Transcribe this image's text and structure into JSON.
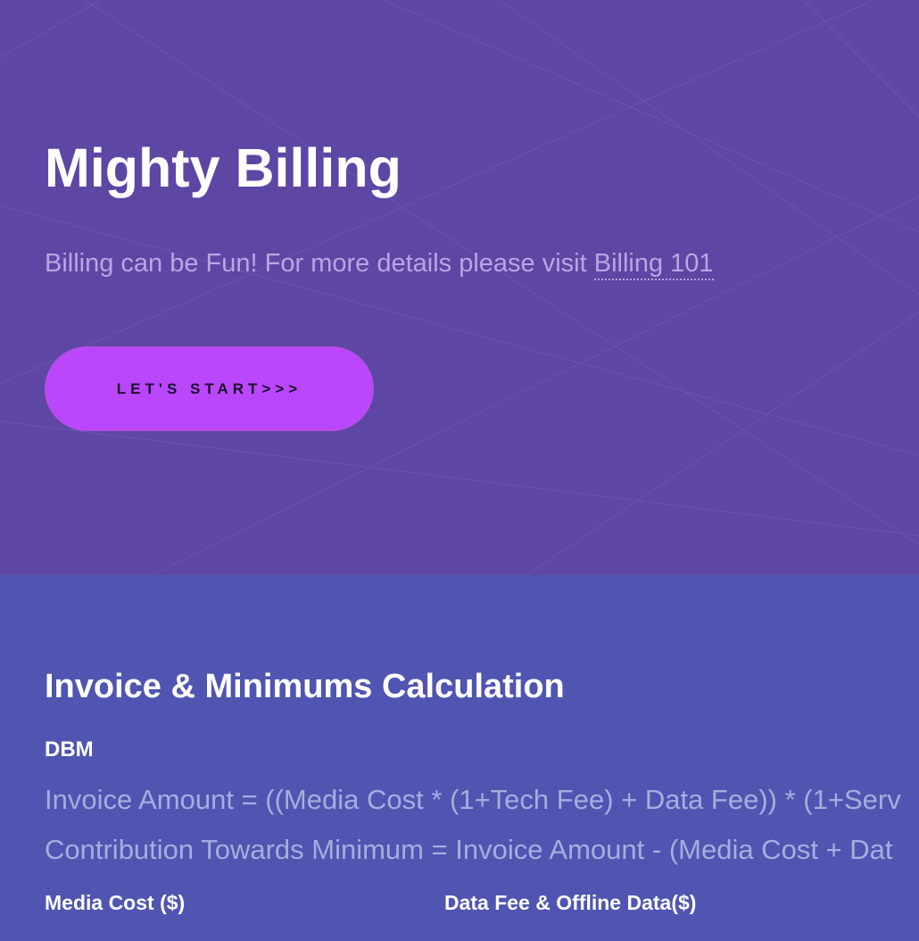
{
  "hero": {
    "title": "Mighty Billing",
    "subtitle_text": "Billing can be Fun! For more details please visit ",
    "subtitle_link": "Billing 101",
    "start_button": "LET'S START>>>"
  },
  "calculation": {
    "heading": "Invoice & Minimums Calculation",
    "subheading": "DBM",
    "formulas": [
      "Invoice Amount = ((Media Cost * (1+Tech Fee) + Data Fee)) * (1+Serv",
      "Contribution Towards Minimum = Invoice Amount - (Media Cost + Dat"
    ],
    "fields": {
      "media_cost_label": "Media Cost ($)",
      "data_fee_label": "Data Fee & Offline Data($)"
    }
  },
  "colors": {
    "hero_background": "#5d46a4",
    "section_background": "#4f55b0",
    "button_background": "#ba47fb",
    "muted_text": "#b7a7e3",
    "formula_text": "#a7addf"
  }
}
